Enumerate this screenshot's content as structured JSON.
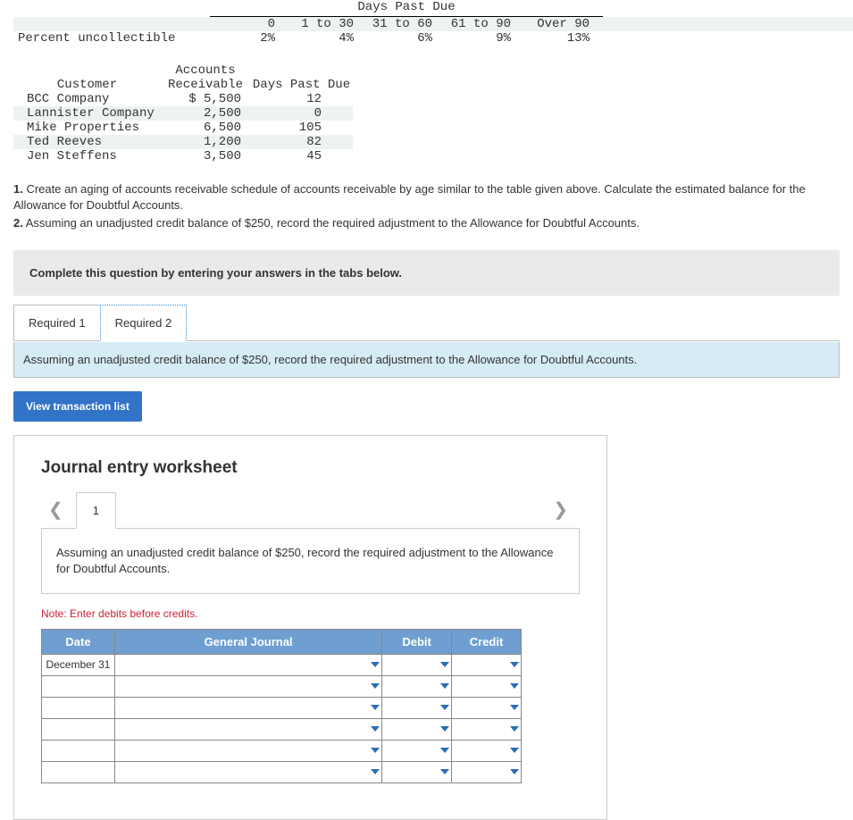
{
  "aging": {
    "header_title": "Days Past Due",
    "cols": [
      "0",
      "1 to 30",
      "31 to 60",
      "61 to 90",
      "Over 90"
    ],
    "row_label": "Percent uncollectible",
    "row_values": [
      "2%",
      "4%",
      "6%",
      "9%",
      "13%"
    ]
  },
  "customers": {
    "headers": {
      "c1": "Customer",
      "c2a": "Accounts",
      "c2b": "Receivable",
      "c3": "Days Past Due"
    },
    "rows": [
      {
        "name": "BCC Company",
        "ar": "$ 5,500",
        "days": "12"
      },
      {
        "name": "Lannister Company",
        "ar": "2,500",
        "days": "0"
      },
      {
        "name": "Mike Properties",
        "ar": "6,500",
        "days": "105"
      },
      {
        "name": "Ted Reeves",
        "ar": "1,200",
        "days": "82"
      },
      {
        "name": "Jen Steffens",
        "ar": "3,500",
        "days": "45"
      }
    ]
  },
  "questions": {
    "q1num": "1.",
    "q1": " Create an aging of accounts receivable schedule of accounts receivable by age similar to the table given above. Calculate the estimated balance for the Allowance for Doubtful Accounts.",
    "q2num": "2.",
    "q2": " Assuming an unadjusted credit balance of $250, record the required adjustment to the Allowance for Doubtful Accounts."
  },
  "instruction": "Complete this question by entering your answers in the tabs below.",
  "tabs": {
    "t1": "Required 1",
    "t2": "Required 2"
  },
  "prompt": "Assuming an unadjusted credit balance of $250, record the required adjustment to the Allowance for Doubtful Accounts.",
  "view_btn": "View transaction list",
  "worksheet": {
    "title": "Journal entry worksheet",
    "page": "1",
    "prompt": "Assuming an unadjusted credit balance of $250, record the required adjustment to the Allowance for Doubtful Accounts.",
    "note": "Note: Enter debits before credits.",
    "headers": {
      "date": "Date",
      "gj": "General Journal",
      "debit": "Debit",
      "credit": "Credit"
    },
    "first_date": "December 31"
  }
}
